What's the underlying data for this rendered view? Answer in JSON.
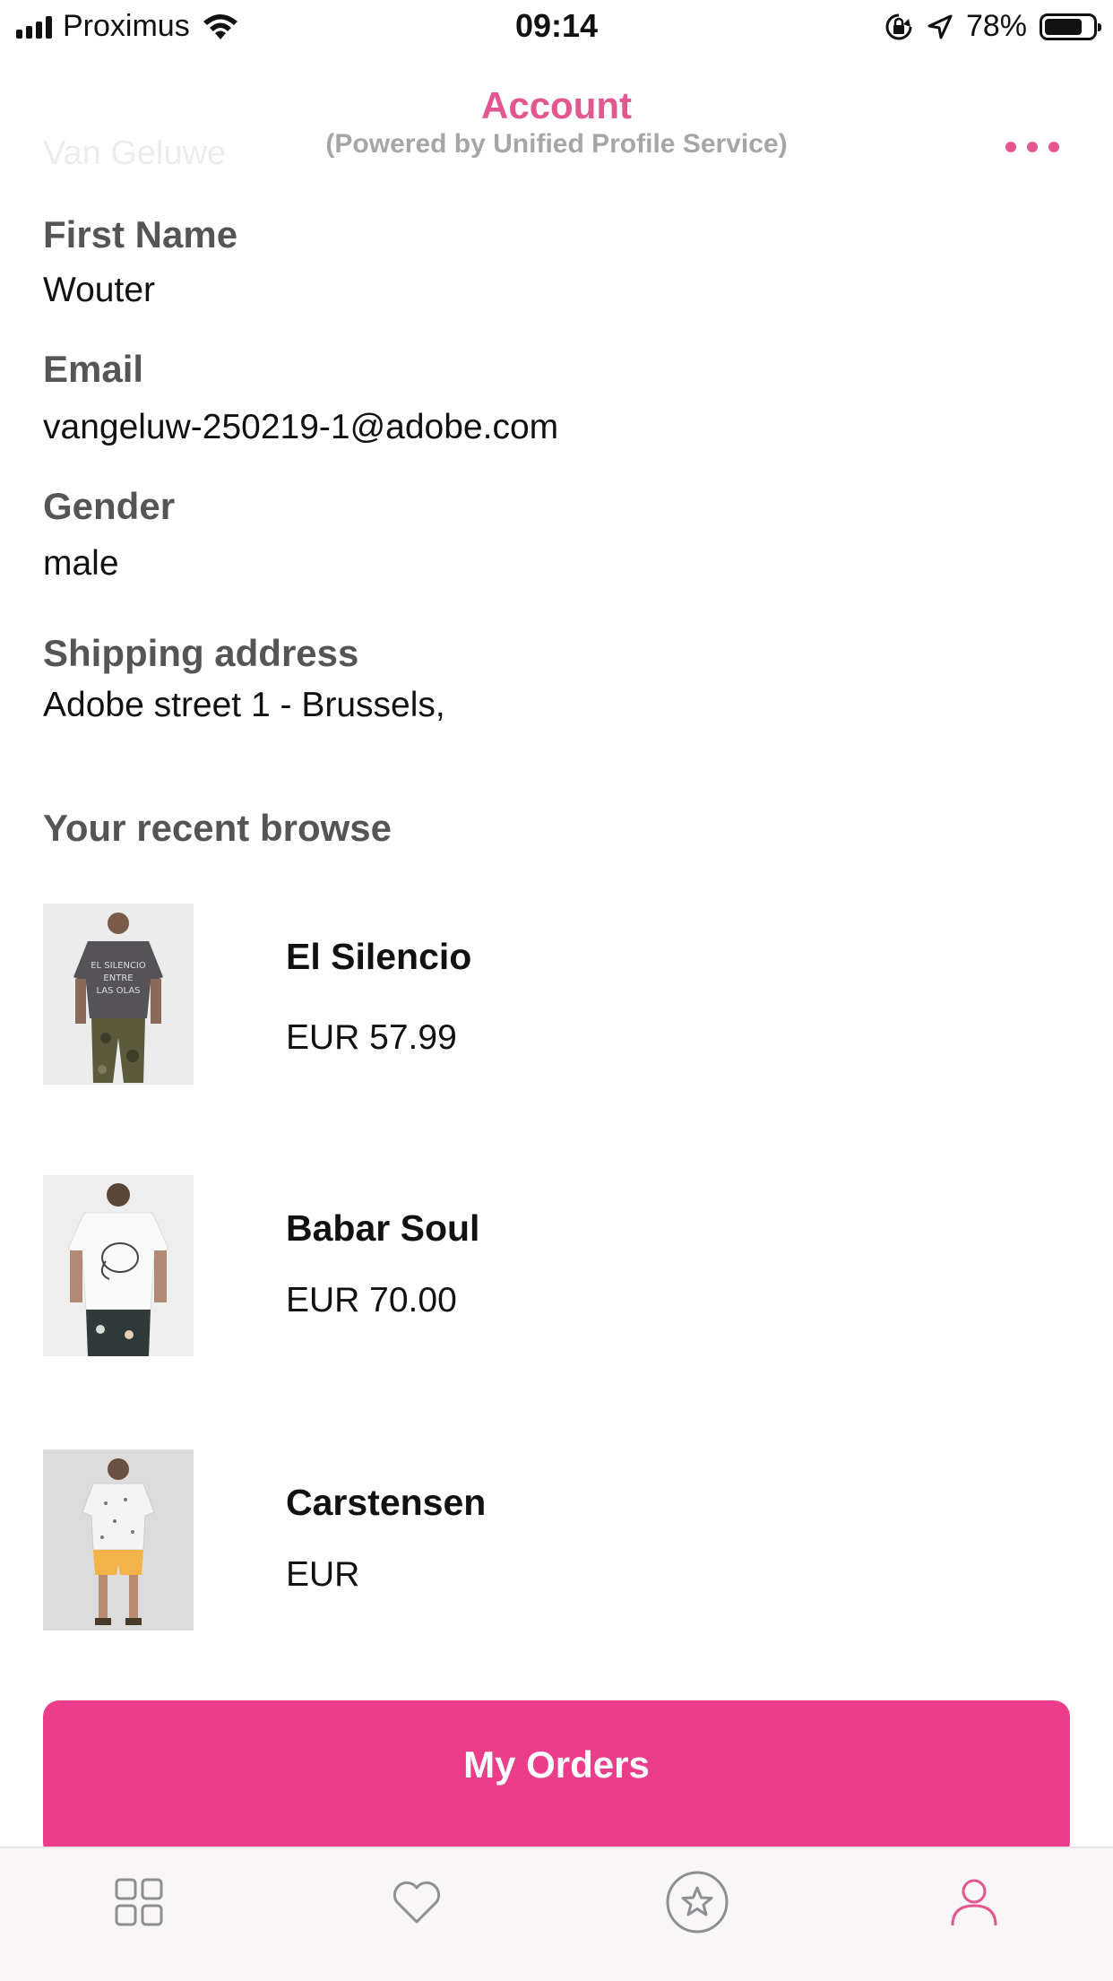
{
  "status_bar": {
    "carrier": "Proximus",
    "time": "09:14",
    "battery_percent": "78%",
    "battery_level": 0.78,
    "icons": [
      "signal-icon",
      "wifi-icon",
      "orientation-lock-icon",
      "location-arrow-icon",
      "battery-icon"
    ]
  },
  "header": {
    "title": "Account",
    "subtitle": "(Powered by Unified Profile Service)",
    "more_icon": "more-dots-icon",
    "accent_color": "#e2578f"
  },
  "profile": {
    "last_name_partial": "Van Geluwe",
    "first_name_label": "First Name",
    "first_name": "Wouter",
    "email_label": "Email",
    "email": "vangeluw-250219-1@adobe.com",
    "gender_label": "Gender",
    "gender": "male",
    "shipping_label": "Shipping address",
    "shipping_address": "Adobe street 1 - Brussels,"
  },
  "recent_browse": {
    "title": "Your recent browse",
    "items": [
      {
        "name": "El Silencio",
        "price": "EUR 57.99"
      },
      {
        "name": "Babar Soul",
        "price": "EUR 70.00"
      },
      {
        "name": "Carstensen",
        "price": "EUR"
      }
    ]
  },
  "orders_button": {
    "label": "My Orders",
    "color": "#ec3d8a"
  },
  "tab_bar": {
    "tabs": [
      {
        "icon": "grid-icon",
        "active": false
      },
      {
        "icon": "heart-icon",
        "active": false
      },
      {
        "icon": "star-circle-icon",
        "active": false
      },
      {
        "icon": "user-icon",
        "active": true
      }
    ]
  }
}
